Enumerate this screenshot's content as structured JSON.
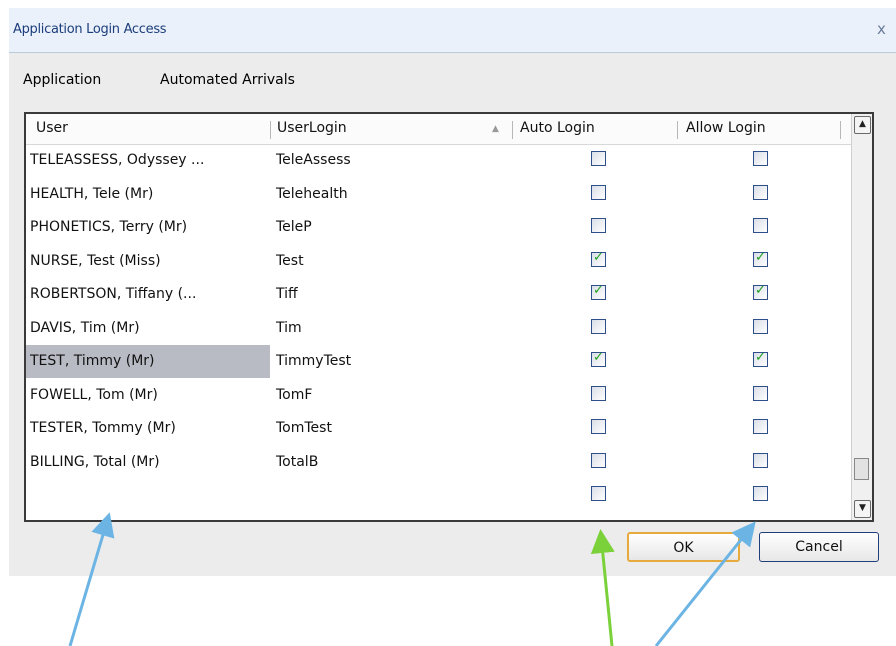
{
  "dialog": {
    "title": "Application Login Access",
    "close_glyph": "x"
  },
  "menu": {
    "items": [
      "Application",
      "Automated Arrivals"
    ]
  },
  "grid": {
    "columns": [
      "User",
      "UserLogin",
      "Auto Login",
      "Allow Login"
    ],
    "sort_indicator": "▲",
    "rows": [
      {
        "user": "TELEASSESS, Odyssey ...",
        "login": "TeleAssess",
        "auto": false,
        "allow": false
      },
      {
        "user": "HEALTH, Tele (Mr)",
        "login": "Telehealth",
        "auto": false,
        "allow": false
      },
      {
        "user": "PHONETICS, Terry (Mr)",
        "login": "TeleP",
        "auto": false,
        "allow": false
      },
      {
        "user": "NURSE, Test (Miss)",
        "login": "Test",
        "auto": true,
        "allow": true
      },
      {
        "user": "ROBERTSON, Tiffany (...",
        "login": "Tiff",
        "auto": true,
        "allow": true
      },
      {
        "user": "DAVIS, Tim (Mr)",
        "login": "Tim",
        "auto": false,
        "allow": false
      },
      {
        "user": "TEST, Timmy (Mr)",
        "login": "TimmyTest",
        "auto": true,
        "allow": true,
        "selected": true
      },
      {
        "user": "FOWELL, Tom (Mr)",
        "login": "TomF",
        "auto": false,
        "allow": false
      },
      {
        "user": "TESTER, Tommy (Mr)",
        "login": "TomTest",
        "auto": false,
        "allow": false
      },
      {
        "user": "BILLING, Total (Mr)",
        "login": "TotalB",
        "auto": false,
        "allow": false
      },
      {
        "user": "",
        "login": "",
        "auto": false,
        "allow": false
      }
    ]
  },
  "buttons": {
    "ok": "OK",
    "cancel": "Cancel"
  },
  "icons": {
    "scroll_up": "chevron-up-icon",
    "scroll_down": "chevron-down-icon",
    "check": "checkmark-icon"
  },
  "colors": {
    "check": "#20a020",
    "selected_row": "#b9bbc4",
    "arrow_blue": "#6cb4e4",
    "arrow_green": "#7bd13a"
  }
}
